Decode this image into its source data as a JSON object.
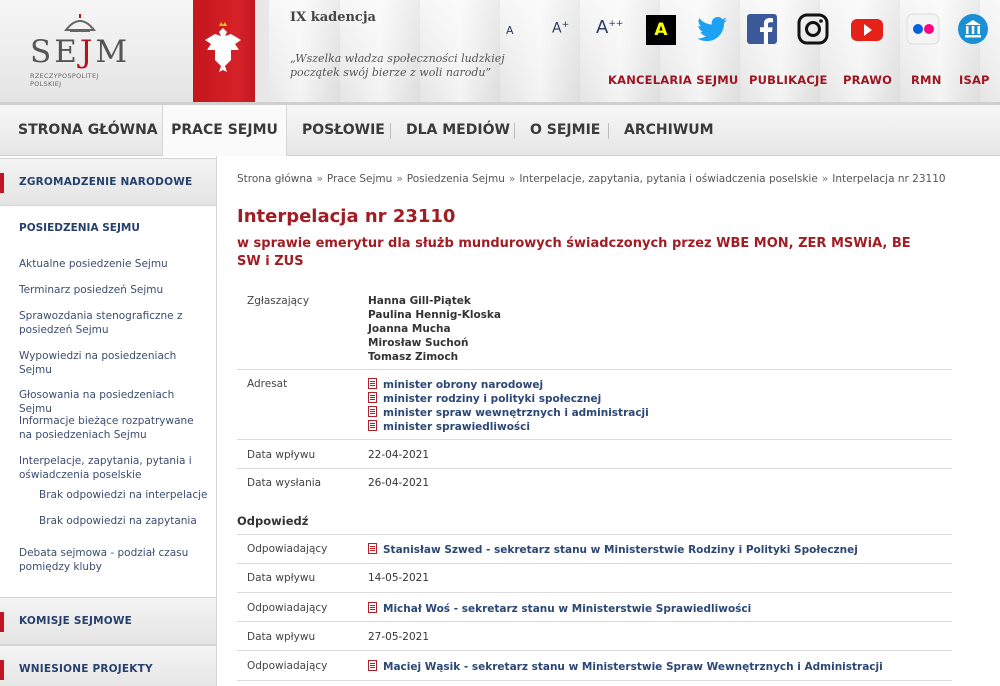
{
  "header": {
    "logo_text_left": "SE",
    "logo_text_j": "J",
    "logo_text_right": "M",
    "logo_subtitle": "RZECZYPOSPOLITEJ POLSKIEJ",
    "kadencja": "IX kadencja",
    "quote": "„Wszelka władza społeczności ludzkiej początek swój bierze z woli narodu”",
    "font_small": "A",
    "font_medium": "A",
    "font_medium_sup": "+",
    "font_large": "A",
    "font_large_sup": "++",
    "contrast": "A",
    "top_links": [
      "KANCELARIA SEJMU",
      "PUBLIKACJE",
      "PRAWO",
      "RMN",
      "ISAP"
    ],
    "social_icons": [
      "twitter-icon",
      "facebook-icon",
      "instagram-icon",
      "youtube-icon",
      "flickr-icon",
      "institution-icon"
    ]
  },
  "nav": {
    "items": [
      "STRONA GŁÓWNA",
      "PRACE SEJMU",
      "POSŁOWIE",
      "DLA MEDIÓW",
      "O SEJMIE",
      "ARCHIWUM"
    ],
    "active": "PRACE SEJMU"
  },
  "sidebar": {
    "head1": "ZGROMADZENIE NARODOWE",
    "title": "POSIEDZENIA SEJMU",
    "links": [
      "Aktualne posiedzenie Sejmu",
      "Terminarz posiedzeń Sejmu",
      "Sprawozdania stenograficzne z posiedzeń Sejmu",
      "Wypowiedzi na posiedzeniach Sejmu",
      "Głosowania na posiedzeniach Sejmu",
      "Informacje bieżące rozpatrywane na posiedzeniach Sejmu",
      "Interpelacje, zapytania, pytania i oświadczenia poselskie"
    ],
    "sublinks": [
      "Brak odpowiedzi na interpelacje",
      "Brak odpowiedzi na zapytania"
    ],
    "link_last": "Debata sejmowa - podział czasu pomiędzy kluby",
    "head2": "KOMISJE SEJMOWE",
    "head3": "WNIESIONE PROJEKTY"
  },
  "main": {
    "breadcrumb": [
      "Strona główna",
      "Prace Sejmu",
      "Posiedzenia Sejmu",
      "Interpelacje, zapytania, pytania i oświadczenia poselskie",
      "Interpelacja nr 23110"
    ],
    "breadcrumb_sep": "»",
    "title": "Interpelacja nr 23110",
    "subtitle": "w sprawie emerytur dla służb mundurowych świadczonych przez WBE MON, ZER MSWiA, BE SW i ZUS",
    "label_zglaszajacy": "Zgłaszający",
    "zglaszajacy": [
      "Hanna Gill-Piątek",
      "Paulina Hennig-Kloska",
      "Joanna Mucha",
      "Mirosław Suchoń",
      "Tomasz Zimoch"
    ],
    "label_adresat": "Adresat",
    "adresat": [
      "minister obrony narodowej",
      "minister rodziny i polityki społecznej",
      "minister spraw wewnętrznych i administracji",
      "minister sprawiedliwości"
    ],
    "label_data_wplywu": "Data wpływu",
    "data_wplywu": "22-04-2021",
    "label_data_wyslania": "Data wysłania",
    "data_wyslania": "26-04-2021",
    "odpowiedz_title": "Odpowiedź",
    "label_odpowiadajacy": "Odpowiadający",
    "responses": [
      {
        "who": "Stanisław Szwed - sekretarz stanu w Ministerstwie Rodziny i Polityki Społecznej",
        "date": "14-05-2021"
      },
      {
        "who": "Michał Woś - sekretarz stanu w Ministerstwie Sprawiedliwości",
        "date": "27-05-2021"
      },
      {
        "who": "Maciej Wąsik - sekretarz stanu w Ministerstwie Spraw Wewnętrznych i Administracji"
      }
    ]
  },
  "colors": {
    "accent_red": "#a21c23",
    "link_blue": "#2c4775",
    "nav_text": "#3a3a3a"
  }
}
